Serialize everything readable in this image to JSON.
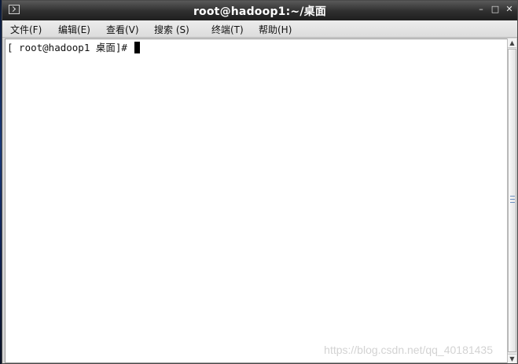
{
  "window": {
    "title": "root@hadoop1:~/桌面",
    "app_icon": "terminal-icon",
    "controls": {
      "minimize": "–",
      "maximize": "□",
      "close": "✕"
    }
  },
  "menubar": {
    "items": [
      {
        "label": "文件(F)"
      },
      {
        "label": "编辑(E)"
      },
      {
        "label": "查看(V)"
      },
      {
        "label": "搜索 (S)"
      },
      {
        "label": "终端(T)"
      },
      {
        "label": "帮助(H)"
      }
    ]
  },
  "terminal": {
    "prompt": "[ root@hadoop1 桌面]# "
  },
  "scrollbar": {
    "up_arrow": "▲",
    "down_arrow": "▼"
  },
  "watermark": {
    "text": "https://blog.csdn.net/qq_40181435"
  }
}
